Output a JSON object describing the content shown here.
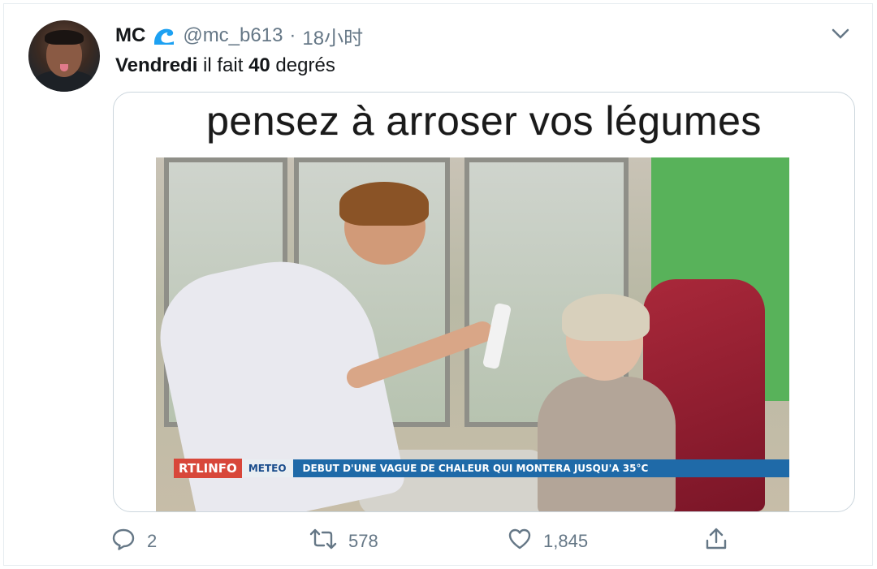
{
  "tweet": {
    "name": "MC",
    "handle": "@mc_b613",
    "separator": "·",
    "time": "18小时",
    "text_parts": {
      "bold1": "Vendredi",
      "plain1": " il fait ",
      "bold2": "40",
      "plain2": " degrés"
    }
  },
  "media": {
    "caption": "pensez à arroser vos légumes",
    "ticker": {
      "brand": "RTLINFO",
      "section": "METEO",
      "headline": "DEBUT D'UNE VAGUE DE CHALEUR QUI MONTERA JUSQU'A 35°C"
    }
  },
  "actions": {
    "replies": "2",
    "retweets": "578",
    "likes": "1,845"
  },
  "icons": {
    "verified_badge": "wave-icon",
    "menu": "chevron-down-icon",
    "reply": "reply-icon",
    "retweet": "retweet-icon",
    "like": "heart-icon",
    "share": "share-icon"
  },
  "colors": {
    "text_primary": "#14171a",
    "text_secondary": "#657786",
    "accent": "#1da1f2",
    "border": "#e6ecf0"
  }
}
